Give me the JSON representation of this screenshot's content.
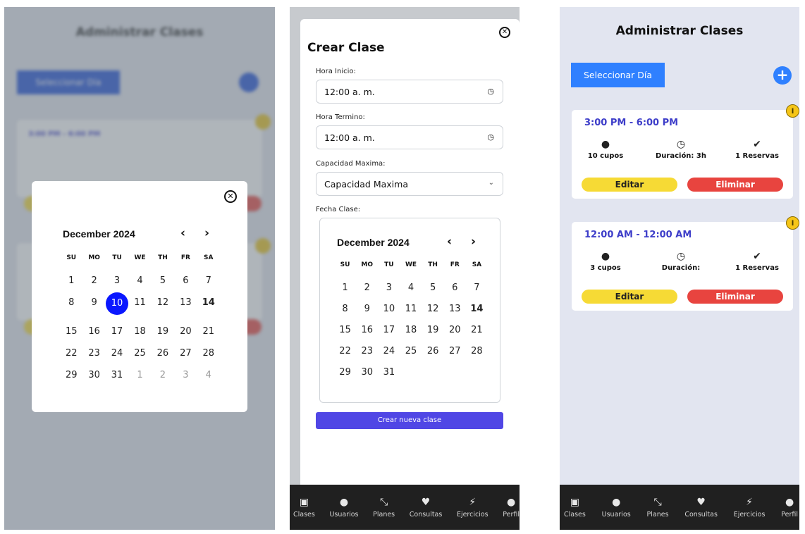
{
  "app": {
    "title": "Administrar Clases",
    "select_day_label": "Seleccionar Día",
    "add_label": "+"
  },
  "nav": [
    {
      "label": "Clases",
      "icon": "calendar-icon"
    },
    {
      "label": "Usuarios",
      "icon": "user-icon"
    },
    {
      "label": "Planes",
      "icon": "expand-arrows-icon"
    },
    {
      "label": "Consultas",
      "icon": "heart-icon"
    },
    {
      "label": "Ejercicios",
      "icon": "bolt-icon"
    },
    {
      "label": "Perfil",
      "icon": "profile-icon"
    }
  ],
  "calendar": {
    "month": "December 2024",
    "dows": [
      "SU",
      "MO",
      "TU",
      "WE",
      "TH",
      "FR",
      "SA"
    ],
    "selected_day": "10",
    "today": "14"
  },
  "create_form": {
    "title": "Crear Clase",
    "start_label": "Hora Inicio:",
    "start_value": "12:00 a. m.",
    "end_label": "Hora Termino:",
    "end_value": "12:00 a. m.",
    "capacity_label": "Capacidad Maxima:",
    "capacity_value": "Capacidad Maxima",
    "date_label": "Fecha Clase:",
    "submit_label": "Crear nueva clase"
  },
  "classes": [
    {
      "time": "3:00 PM - 6:00 PM",
      "cupos": "10 cupos",
      "duracion": "Duración: 3h",
      "reservas": "1 Reservas",
      "edit": "Editar",
      "delete": "Eliminar"
    },
    {
      "time": "12:00 AM - 12:00 AM",
      "cupos": "3 cupos",
      "duracion": "Duración:",
      "reservas": "1 Reservas",
      "edit": "Editar",
      "delete": "Eliminar"
    }
  ],
  "colors": {
    "primary_blue": "#2f80ff",
    "selected_day": "#0a17ff",
    "submit_purple": "#5046e5",
    "edit_yellow": "#f6da35",
    "delete_red": "#e8443f",
    "time_text": "#3d3dc9"
  }
}
